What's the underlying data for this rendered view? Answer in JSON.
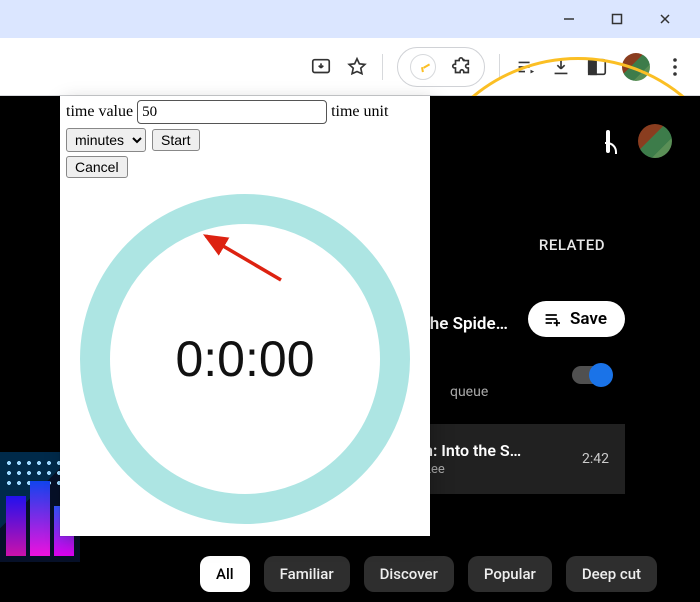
{
  "toolbar": {},
  "page": {
    "tab_related_label": "RELATED",
    "spide_label": "the Spide…",
    "save_label": "Save",
    "queue_label": "queue",
    "video": {
      "title": "n: Into the S…",
      "by": "Lee",
      "duration": "2:42"
    },
    "chips": [
      "All",
      "Familiar",
      "Discover",
      "Popular",
      "Deep cut"
    ]
  },
  "timer": {
    "label_time_value": "time value",
    "input_value": "50",
    "label_time_unit": "time unit",
    "unit_selected": "minutes",
    "start_label": "Start",
    "cancel_label": "Cancel",
    "display": "0:0:00"
  }
}
